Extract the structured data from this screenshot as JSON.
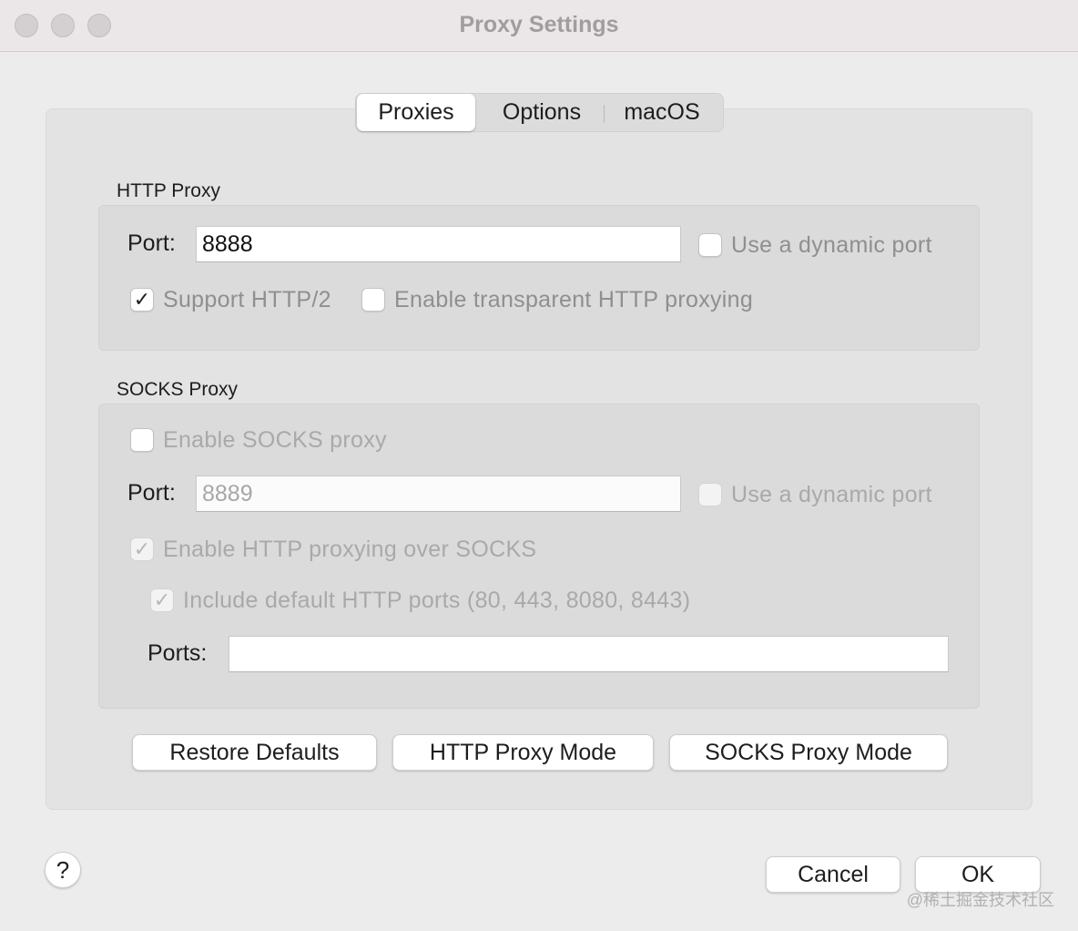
{
  "window": {
    "title": "Proxy Settings"
  },
  "tabs": [
    {
      "label": "Proxies",
      "selected": true
    },
    {
      "label": "Options",
      "selected": false
    },
    {
      "label": "macOS",
      "selected": false
    }
  ],
  "http_proxy": {
    "section_label": "HTTP Proxy",
    "port_label": "Port:",
    "port_value": "8888",
    "dynamic_port_label": "Use a dynamic port",
    "dynamic_port_checked": false,
    "support_http2_label": "Support HTTP/2",
    "support_http2_checked": true,
    "transparent_label": "Enable transparent HTTP proxying",
    "transparent_checked": false
  },
  "socks_proxy": {
    "section_label": "SOCKS Proxy",
    "enable_label": "Enable SOCKS proxy",
    "enable_checked": false,
    "port_label": "Port:",
    "port_value": "8889",
    "dynamic_port_label": "Use a dynamic port",
    "dynamic_port_checked": false,
    "http_over_socks_label": "Enable HTTP proxying over SOCKS",
    "http_over_socks_checked": true,
    "include_default_ports_label": "Include default HTTP ports (80, 443, 8080, 8443)",
    "include_default_ports_checked": true,
    "ports_label": "Ports:",
    "ports_value": ""
  },
  "actions": {
    "restore_defaults": "Restore Defaults",
    "http_proxy_mode": "HTTP Proxy Mode",
    "socks_proxy_mode": "SOCKS Proxy Mode",
    "help": "?",
    "cancel": "Cancel",
    "ok": "OK"
  },
  "watermark": "@稀土掘金技术社区",
  "colors": {
    "window_bg": "#ececec",
    "titlebar_bg": "#ebe6e7",
    "panel_bg": "#e3e3e3",
    "inner_box_bg": "#dbdbdb",
    "disabled_text": "#a9a9a9"
  }
}
